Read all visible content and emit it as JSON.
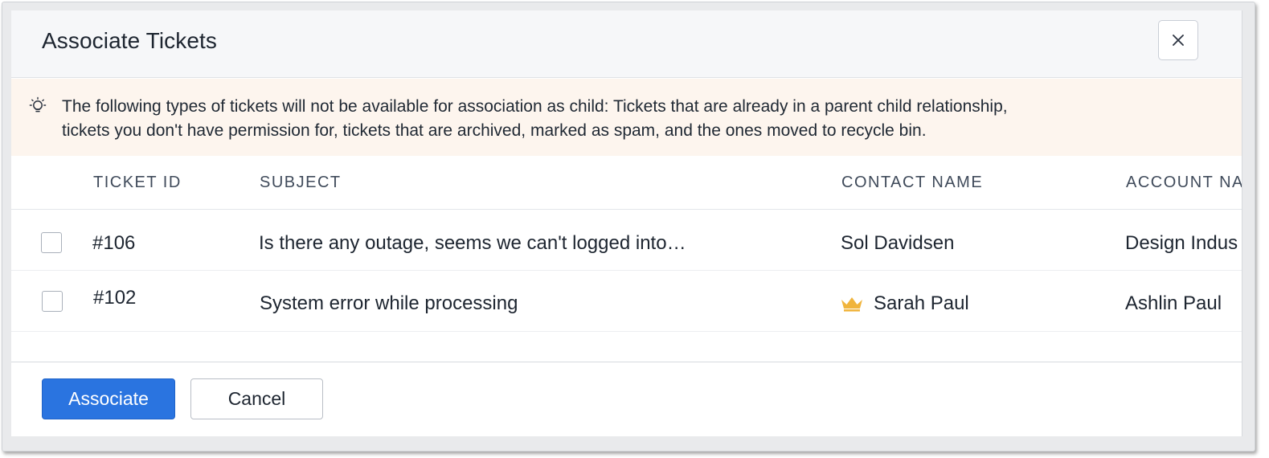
{
  "dialog": {
    "title": "Associate Tickets",
    "close_icon": "close-icon"
  },
  "notice": {
    "icon": "lightbulb-icon",
    "line1": "The following types of tickets will not be available for association as child: Tickets that are already in a parent child relationship,",
    "line2": "tickets you don't have permission for, tickets that are archived, marked as spam, and the ones moved to recycle bin."
  },
  "table": {
    "columns": [
      "TICKET ID",
      "SUBJECT",
      "CONTACT NAME",
      "ACCOUNT NA"
    ],
    "rows": [
      {
        "ticket_id": "#106",
        "subject": "Is there any outage, seems we can't logged into…",
        "contact": "Sol Davidsen",
        "account": "Design Indus",
        "checked": false
      },
      {
        "ticket_id": "#102",
        "subject": "System error while processing",
        "contact": "Sarah Paul",
        "contact_icon": "crown-icon",
        "account": "Ashlin Paul",
        "checked": false
      }
    ]
  },
  "footer": {
    "associate_label": "Associate",
    "cancel_label": "Cancel"
  },
  "colors": {
    "primary": "#2a74e0",
    "notice_bg": "#fdf5ee",
    "crown": "#f0b43c"
  }
}
